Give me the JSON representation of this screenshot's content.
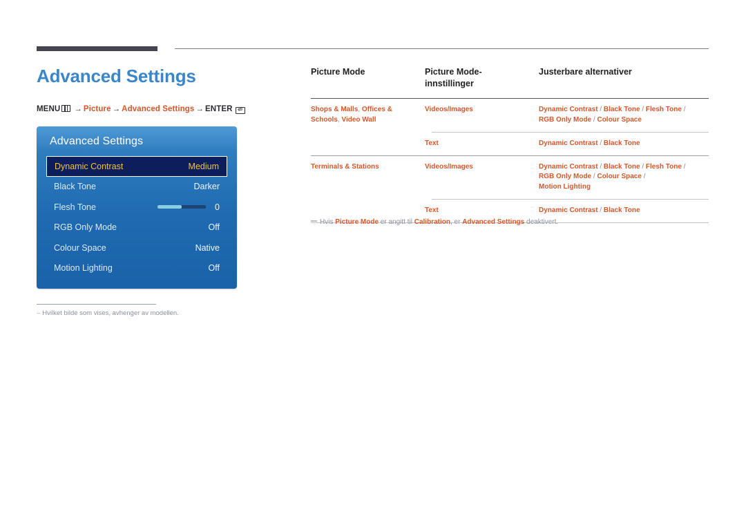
{
  "page": {
    "title": "Advanced Settings"
  },
  "breadcrumb": {
    "menu_label": "MENU",
    "menu_icon": "menu-grid-icon",
    "arrow": "→",
    "item1": "Picture",
    "item2": "Advanced Settings",
    "enter_label": "ENTER",
    "enter_icon": "enter-key-icon"
  },
  "osd": {
    "title": "Advanced Settings",
    "rows": [
      {
        "label": "Dynamic Contrast",
        "value": "Medium",
        "selected": true,
        "type": "value"
      },
      {
        "label": "Black Tone",
        "value": "Darker",
        "selected": false,
        "type": "value"
      },
      {
        "label": "Flesh Tone",
        "value": "0",
        "selected": false,
        "type": "slider",
        "slider_percent": 50
      },
      {
        "label": "RGB Only Mode",
        "value": "Off",
        "selected": false,
        "type": "value"
      },
      {
        "label": "Colour Space",
        "value": "Native",
        "selected": false,
        "type": "value"
      },
      {
        "label": "Motion Lighting",
        "value": "Off",
        "selected": false,
        "type": "value"
      }
    ]
  },
  "left_note": {
    "dash": "–",
    "text": "Hvilket bilde som vises, avhenger av modellen."
  },
  "table": {
    "headers": {
      "col1": "Picture Mode",
      "col2": "Picture Mode-\ninnstillinger",
      "col2_line1": "Picture Mode-",
      "col2_line2": "innstillinger",
      "col3": "Justerbare alternativer"
    },
    "rows": [
      {
        "col1_a": "Shops & Malls",
        "col1_comma1": ",",
        "col1_b": "Offices & Schools",
        "col1_comma2": ",",
        "col1_c": "Video Wall",
        "col2": "Videos/Images",
        "col3_line1_a": "Dynamic Contrast",
        "col3_line1_b": "Black Tone",
        "col3_line1_c": "Flesh Tone",
        "col3_line2_a": "RGB Only Mode",
        "col3_line2_b": "Colour Space"
      },
      {
        "col1": "",
        "col2": "Text",
        "col3_a": "Dynamic Contrast",
        "col3_b": "Black Tone"
      },
      {
        "col1": "Terminals & Stations",
        "col2": "Videos/Images",
        "col3_line1_a": "Dynamic Contrast",
        "col3_line1_b": "Black Tone",
        "col3_line1_c": "Flesh Tone",
        "col3_line2_a": "RGB Only Mode",
        "col3_line2_b": "Colour Space",
        "col3_line3_a": "Motion Lighting"
      },
      {
        "col1": "",
        "col2": "Text",
        "col3_a": "Dynamic Contrast",
        "col3_b": "Black Tone"
      }
    ],
    "separator": "/"
  },
  "right_note": {
    "t1": "Hvis ",
    "b1": "Picture Mode",
    "t2": " er angitt til ",
    "b2": "Calibration",
    "t3": ", er ",
    "b3": "Advanced Settings",
    "t4": " deaktivert."
  }
}
